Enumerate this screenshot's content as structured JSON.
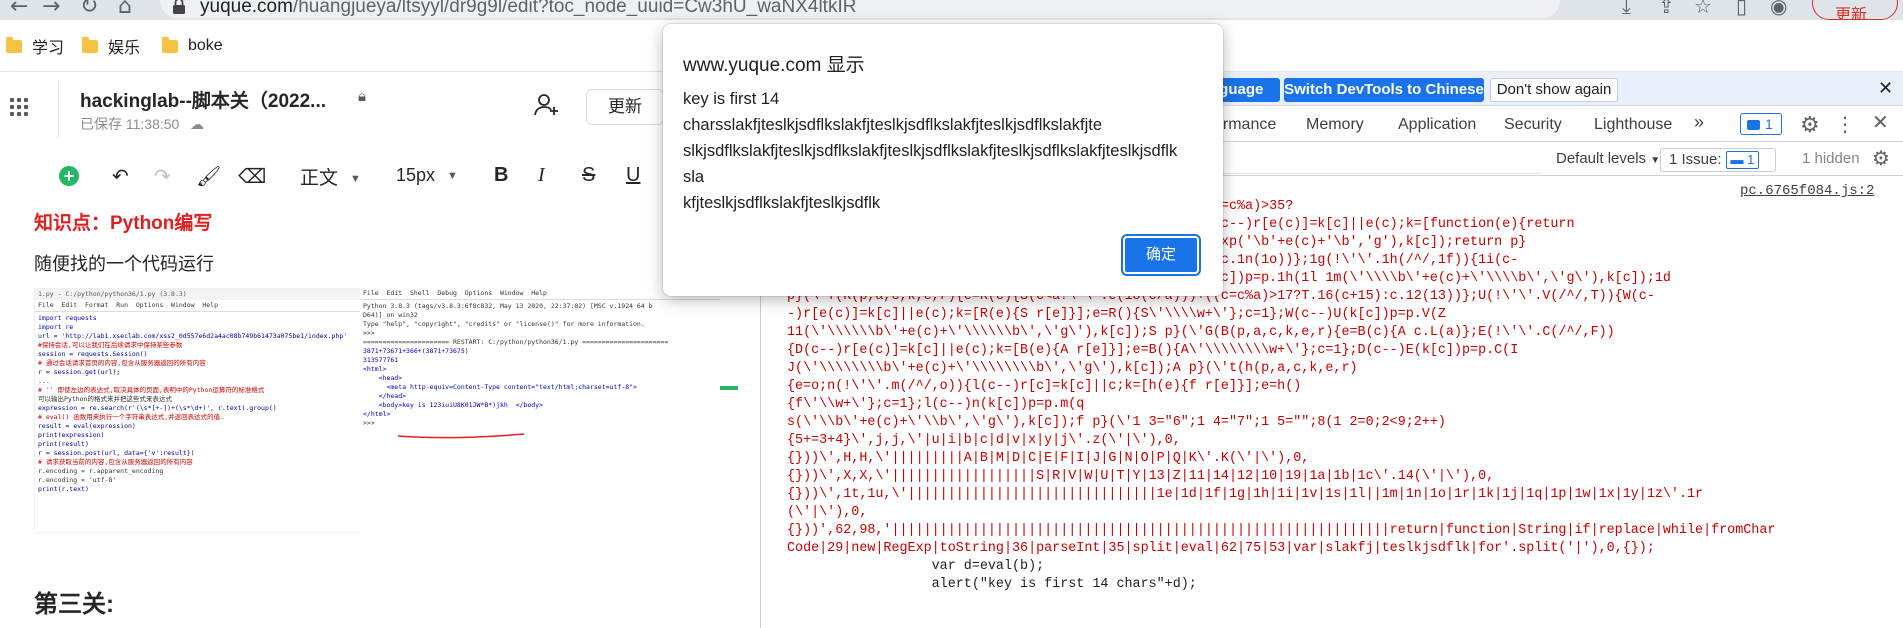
{
  "browser": {
    "url_host": "yuque.com",
    "url_path": "/huangjueya/ltsyyl/dr9g9l/edit?toc_node_uuid=Cw3hU_waNX4ltkIR",
    "update_label": "更新",
    "bookmarks": [
      "学习",
      "娱乐",
      "boke"
    ]
  },
  "doc": {
    "title": "hackinglab--脚本关（2022...",
    "save_status": "已保存 11:38:50",
    "update_button": "更新",
    "toolbar": {
      "style_value": "正文",
      "size_value": "15px"
    },
    "heading_knowledge": "知识点：Python编写",
    "para1": "随便找的一个代码运行",
    "heading3": "第三关:"
  },
  "devtools": {
    "infobar": {
      "language_button": "nguage",
      "switch_button": "Switch DevTools to Chinese",
      "dont_show_button": "Don't show again"
    },
    "tabs": [
      "ormance",
      "Memory",
      "Application",
      "Security",
      "Lighthouse"
    ],
    "badge_count": "1",
    "levels_label": "Default levels",
    "issues_label": "1 Issue:",
    "issues_count": "1",
    "hidden_label": "1 hidden",
    "source_link": "pc.6765f084.js:2",
    "console_lines": [
      "                               ':e(parseInt(c/a)))+((c=c%a)>35?",
      "                               ace(/^/,String)){while(c--)r[e(c)]=k[c]||e(c);k=[function(e){return",
      "                               ]]}p=p.replace(new RegExp('\\b'+e(c)+'\\b','g'),k[c]);return p}",
      "                               (c=c%a)>1q?1f.1j(c+1k):c.1n(1o))};1g(!\\'\\'.1h(/^/,1f)){1i(c-",
      "                               w+\\'};c=1};1i(c--)1g(k[c])p=p.1h(1l 1m(\\'\\\\\\\\b\\'+e(c)+\\'\\\\\\\\b\\',\\'g\\'),k[c]);1d",
      "p}(\\'Y(R(p,a,c,k,e,r){e=R(c){S(c<a?\\'\\':e(18(c/a)))+((c=c%a)>17?T.16(c+15):c.12(13))};U(!\\'\\'.V(/^/,T)){W(c-",
      "-)r[e(c)]=k[c]||e(c);k=[R(e){S r[e]}];e=R(){S\\'\\\\\\\\w+\\'};c=1};W(c--)U(k[c])p=p.V(Z",
      "11(\\'\\\\\\\\\\\\b\\'+e(c)+\\'\\\\\\\\\\\\b\\',\\'g\\'),k[c]);S p}(\\'G(B(p,a,c,k,e,r){e=B(c){A c.L(a)};E(!\\'\\'.C(/^/,F))",
      "{D(c--)r[e(c)]=k[c]||e(c);k=[B(e){A r[e]}];e=B(){A\\'\\\\\\\\\\\\\\\\w+\\'};c=1};D(c--)E(k[c])p=p.C(I",
      "J(\\'\\\\\\\\\\\\\\\\b\\'+e(c)+\\'\\\\\\\\\\\\\\\\b\\',\\'g\\'),k[c]);A p}(\\'t(h(p,a,c,k,e,r)",
      "{e=o;n(!\\'\\'.m(/^/,o)){l(c--)r[c]=k[c]||c;k=[h(e){f r[e]}];e=h()",
      "{f\\'\\\\w+\\'};c=1};l(c--)n(k[c])p=p.m(q",
      "s(\\'\\\\b\\'+e(c)+\\'\\\\b\\',\\'g\\'),k[c]);f p}(\\'1 3=\"6\";1 4=\"7\";1 5=\"\";8(1 2=0;2<9;2++)",
      "{5+=3+4}\\',j,j,\\'|u|i|b|c|d|v|x|y|j\\'.z(\\'|\\'),0,",
      "{}))\\',H,H,\\'|||||||||A|B|M|D|C|E|F|I|J|G|N|O|P|Q|K\\'.K(\\'|\\'),0,",
      "{}))\\',X,X,\\'||||||||||||||||||S|R|V|W|U|T|Y|13|Z|11|14|12|10|19|1a|1b|1c\\'.14(\\'|\\'),0,",
      "{}))\\',1t,1u,\\'|||||||||||||||||||||||||||||||1e|1d|1f|1g|1h|1i|1v|1s|1l||1m|1n|1o|1r|1k|1j|1q|1p|1w|1x|1y|1z\\'.1r",
      "(\\'|\\'),0,",
      "{}))',62,98,'||||||||||||||||||||||||||||||||||||||||||||||||||||||||||||||return|function|String|if|replace|while|fromChar",
      "Code|29|new|RegExp|toString|36|parseInt|35|split|eval|62|75|53|var|slakfj|teslkjsdflk|for'.split('|'),0,{});",
      "                  var d=eval(b);",
      "                  alert(\"key is first 14 chars\"+d);"
    ]
  },
  "dialog": {
    "title": "www.yuque.com 显示",
    "message": "key is first 14\ncharsslakfjteslkjsdflkslakfjteslkjsdflkslakfjteslkjsdflkslakfjte\nslkjsdflkslakfjteslkjsdflkslakfjteslkjsdflkslakfjteslkjsdflkslakfjteslkjsdflk\nsla\nkfjteslkjsdflkslakfjteslkjsdflk",
    "ok_button": "确定"
  },
  "embedded_screenshot": {
    "left_title": "1.py - C:/python/python36/1.py (3.8.3)",
    "left_menu": "File  Edit  Format  Run  Options  Window  Help",
    "left_code": [
      "import requests",
      "import re",
      "url = 'http://lab1.xseclab.com/xss2_0d557e6d2a4ac08b749b61473a075be1/index.php'",
      "#保持会话,可以让我们在后续请求中保持某些参数",
      "session = requests.Session()",
      "",
      "# 通过会话请求首页的内容,包含从服务器返回的所有内容",
      "r = session.get(url);",
      "...",
      "# '' 即使左边的表达式,取决具体的页面,表明中的Python运算符的标准格式",
      "可以输出Python的格式来并把这些式来表达式",
      "",
      "expression = re.search(r'(\\s*[+-])+(\\s*\\d+)', r.text).group()",
      "",
      "# eval() 函数用来执行一个字符串表达式,并返回表达式的值.",
      "result = eval(expression)",
      "",
      "print(expression)",
      "print(result)",
      "",
      "r = session.post(url, data={'v':result})",
      "# 请求获取当前的内容,包含从服务器返回的所有内容",
      "r.encoding = r.apparent_encoding",
      "r.encoding = 'utf-8'",
      "print(r.text)"
    ],
    "right_menu": "File  Edit  Shell  Debug  Options  Window  Help",
    "right_code": [
      "Python 3.8.3 (tags/v3.8.3:6f8c832, May 13 2020, 22:37:02) [MSC v.1924 64 b",
      "D64)] on win32",
      "Type \"help\", \"copyright\", \"credits\" or \"license()\" for more information.",
      ">>>",
      "====================== RESTART: C:/python/python36/1.py ======================",
      "3871+73671+366+(3871+73675)",
      "313577761",
      "<html>",
      "    <head>",
      "      <meta http-equiv=Content-Type content=\"text/html;charset=utf-8\">",
      "    </head>",
      "    <body>key is 123iuiU8K01JW*B*)jkh  </body>",
      "</html>",
      ">>>"
    ]
  }
}
